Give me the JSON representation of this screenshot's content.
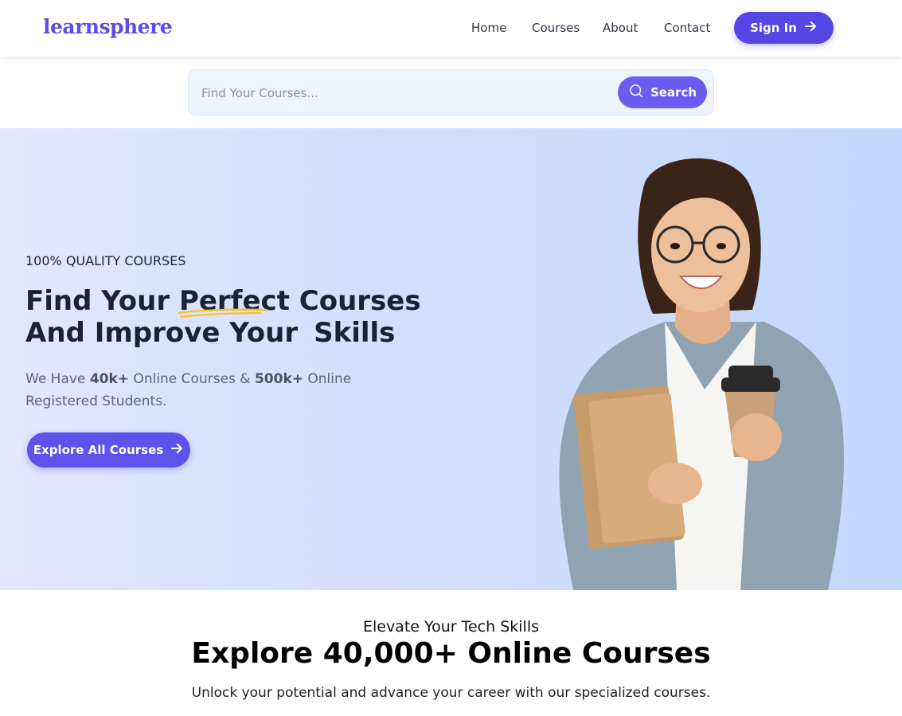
{
  "header": {
    "logo": "learnsphere",
    "nav": [
      "Home",
      "Courses",
      "About",
      "Contact"
    ],
    "signin_label": "Sign In"
  },
  "search": {
    "placeholder": "Find Your Courses...",
    "button_label": "Search"
  },
  "hero": {
    "eyebrow": "100% QUALITY COURSES",
    "title_part1": "Find Your ",
    "title_highlight": "Perfect",
    "title_part2": " Courses",
    "title_line2": "And Improve Your",
    "title_badge": "Skills",
    "desc_prefix": "We Have ",
    "desc_stat1": "40k+",
    "desc_mid": " Online Courses & ",
    "desc_stat2": "500k+",
    "desc_suffix": " Online Registered Students.",
    "explore_label": "Explore All Courses"
  },
  "section": {
    "eyebrow": "Elevate Your Tech Skills",
    "title": "Explore 40,000+ Online Courses",
    "desc": "Unlock your potential and advance your career with our specialized courses."
  },
  "colors": {
    "accent": "#5447e6",
    "highlight": "#fcc419"
  }
}
